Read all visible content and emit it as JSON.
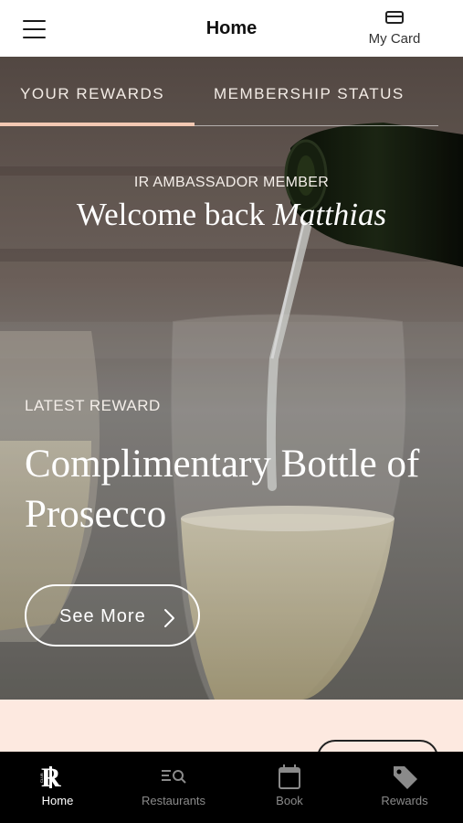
{
  "header": {
    "title": "Home",
    "my_card_label": "My Card"
  },
  "tabs": [
    {
      "label": "YOUR REWARDS",
      "active": true
    },
    {
      "label": "MEMBERSHIP STATUS",
      "active": false
    }
  ],
  "hero": {
    "member_level": "IR AMBASSADOR MEMBER",
    "welcome_prefix": "Welcome back",
    "member_name": "Matthias",
    "reward_tag": "LATEST REWARD",
    "reward_title": "Complimentary Bottle of Prosecco",
    "cta_label": "See More"
  },
  "bottom_nav": [
    {
      "label": "Home",
      "icon": "club-ir-logo-icon",
      "active": true
    },
    {
      "label": "Restaurants",
      "icon": "restaurants-search-icon",
      "active": false
    },
    {
      "label": "Book",
      "icon": "calendar-icon",
      "active": false
    },
    {
      "label": "Rewards",
      "icon": "tag-icon",
      "active": false
    }
  ],
  "colors": {
    "accent_underline": "#f3c9b3",
    "peach_section": "#fde9e0",
    "nav_background": "#000000"
  }
}
